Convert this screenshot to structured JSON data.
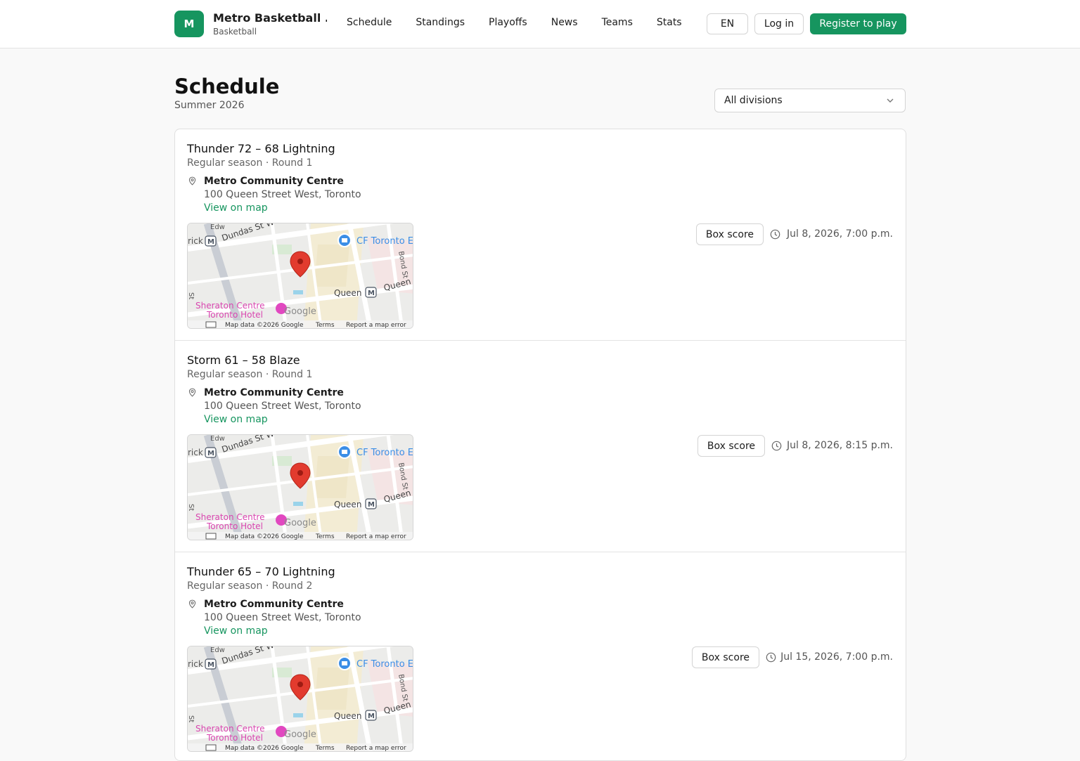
{
  "header": {
    "logo_letter": "M",
    "brand_name": "Metro Basketball ...",
    "brand_sub": "Basketball",
    "nav": [
      "Schedule",
      "Standings",
      "Playoffs",
      "News",
      "Teams",
      "Stats"
    ],
    "lang": "EN",
    "login": "Log in",
    "register": "Register to play",
    "accent": "#16955f"
  },
  "page": {
    "title": "Schedule",
    "subtitle": "Summer 2026",
    "division_select": "All divisions"
  },
  "map_labels": {
    "street_top": "Dundas St W",
    "metro_left": "rick",
    "poi_top": "CF Toronto E",
    "bond": "Bond St",
    "queen1": "Queen",
    "queen2": "Queen",
    "hotel1": "Sheraton Centre",
    "hotel2": "Toronto Hotel",
    "google": "Google",
    "st": "St",
    "edw": "Edw",
    "footer_data": "Map data ©2026 Google",
    "footer_terms": "Terms",
    "footer_report": "Report a map error"
  },
  "games": [
    {
      "score": "Thunder  72 – 68  Lightning",
      "meta": "Regular season · Round 1",
      "venue": "Metro Community Centre",
      "address": "100 Queen Street West, Toronto",
      "map_link": "View on map",
      "box_score": "Box score",
      "when": "Jul 8, 2026, 7:00 p.m."
    },
    {
      "score": "Storm  61 – 58  Blaze",
      "meta": "Regular season · Round 1",
      "venue": "Metro Community Centre",
      "address": "100 Queen Street West, Toronto",
      "map_link": "View on map",
      "box_score": "Box score",
      "when": "Jul 8, 2026, 8:15 p.m."
    },
    {
      "score": "Thunder  65 – 70  Lightning",
      "meta": "Regular season · Round 2",
      "venue": "Metro Community Centre",
      "address": "100 Queen Street West, Toronto",
      "map_link": "View on map",
      "box_score": "Box score",
      "when": "Jul 15, 2026, 7:00 p.m."
    }
  ]
}
